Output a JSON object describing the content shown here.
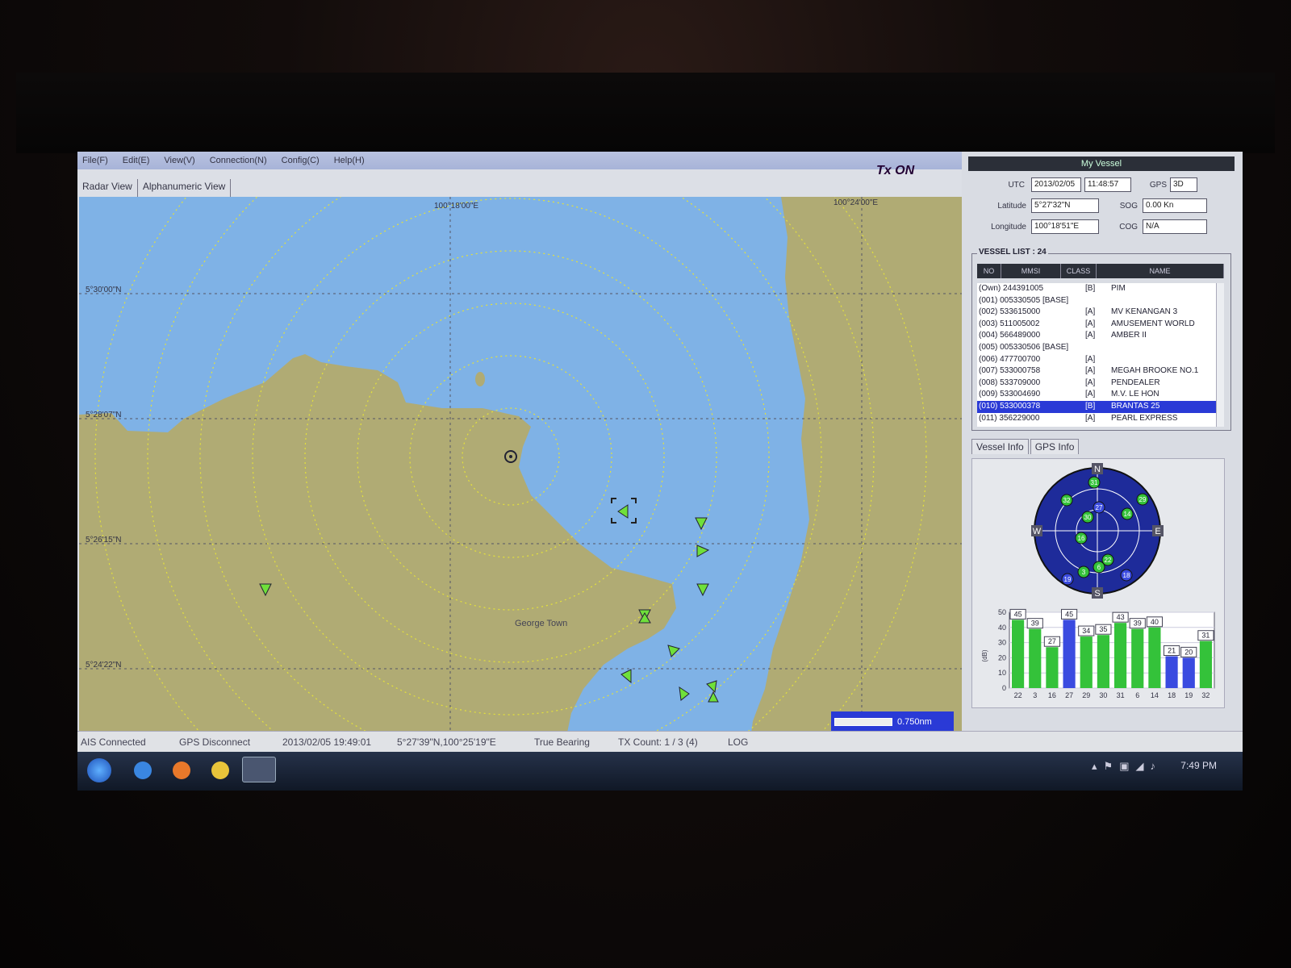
{
  "menu": [
    "File(F)",
    "Edit(E)",
    "View(V)",
    "Connection(N)",
    "Config(C)",
    "Help(H)"
  ],
  "tx_status": "Tx ON",
  "tabs": [
    "Radar View",
    "Alphanumeric View"
  ],
  "map": {
    "lon_labels": [
      "100°18'00\"E",
      "100°24'00\"E"
    ],
    "lat_labels": [
      "5°30'00\"N",
      "5°28'07\"N",
      "5°26'15\"N",
      "5°24'22\"N"
    ],
    "place_label": "George Town",
    "scale": "0.750nm"
  },
  "my_vessel": {
    "title": "My Vessel",
    "utc_label": "UTC",
    "date": "2013/02/05",
    "time": "11:48:57",
    "gps_label": "GPS",
    "gps_fix": "3D",
    "latitude_label": "Latitude",
    "latitude": "5°27'32\"N",
    "longitude_label": "Longitude",
    "longitude": "100°18'51\"E",
    "sog_label": "SOG",
    "sog": "0.00 Kn",
    "cog_label": "COG",
    "cog": "N/A"
  },
  "vessel_list": {
    "title": "VESSEL LIST : 24",
    "columns": [
      "NO",
      "MMSI",
      "CLASS",
      "NAME"
    ],
    "rows": [
      {
        "id": "(Own)  244391005",
        "cls": "[B]",
        "name": "PIM"
      },
      {
        "id": "(001)  005330505 [BASE]",
        "cls": "",
        "name": ""
      },
      {
        "id": "(002)  533615000",
        "cls": "[A]",
        "name": "MV KENANGAN 3"
      },
      {
        "id": "(003)  511005002",
        "cls": "[A]",
        "name": "AMUSEMENT WORLD"
      },
      {
        "id": "(004)  566489000",
        "cls": "[A]",
        "name": "AMBER II"
      },
      {
        "id": "(005)  005330506 [BASE]",
        "cls": "",
        "name": ""
      },
      {
        "id": "(006)  477700700",
        "cls": "[A]",
        "name": ""
      },
      {
        "id": "(007)  533000758",
        "cls": "[A]",
        "name": "MEGAH BROOKE NO.1"
      },
      {
        "id": "(008)  533709000",
        "cls": "[A]",
        "name": "PENDEALER"
      },
      {
        "id": "(009)  533004690",
        "cls": "[A]",
        "name": "M.V. LE HON"
      },
      {
        "id": "(010)  533000378",
        "cls": "[B]",
        "name": "BRANTAS 25"
      },
      {
        "id": "(011)  356229000",
        "cls": "[A]",
        "name": "PEARL EXPRESS"
      }
    ],
    "selected_index": 10
  },
  "info_tabs": [
    "Vessel Info",
    "GPS Info"
  ],
  "sky": {
    "directions": [
      "N",
      "E",
      "S",
      "W"
    ],
    "satellites": [
      {
        "prn": "31",
        "color": "#34c23a"
      },
      {
        "prn": "32",
        "color": "#34c23a"
      },
      {
        "prn": "29",
        "color": "#34c23a"
      },
      {
        "prn": "27",
        "color": "#3a4be0"
      },
      {
        "prn": "14",
        "color": "#34c23a"
      },
      {
        "prn": "30",
        "color": "#34c23a"
      },
      {
        "prn": "16",
        "color": "#34c23a"
      },
      {
        "prn": "22",
        "color": "#34c23a"
      },
      {
        "prn": "6",
        "color": "#34c23a"
      },
      {
        "prn": "3",
        "color": "#34c23a"
      },
      {
        "prn": "18",
        "color": "#3a4be0"
      },
      {
        "prn": "19",
        "color": "#3a4be0"
      }
    ]
  },
  "chart_data": {
    "type": "bar",
    "ylabel": "(dB)",
    "ylim": [
      0,
      50
    ],
    "yticks": [
      0,
      10,
      20,
      30,
      40,
      50
    ],
    "categories": [
      "22",
      "3",
      "16",
      "27",
      "29",
      "30",
      "31",
      "6",
      "14",
      "18",
      "19",
      "32"
    ],
    "values": [
      45,
      39,
      27,
      45,
      34,
      35,
      43,
      39,
      40,
      21,
      20,
      31
    ],
    "colors": [
      "#34c23a",
      "#34c23a",
      "#34c23a",
      "#3a4be0",
      "#34c23a",
      "#34c23a",
      "#34c23a",
      "#34c23a",
      "#34c23a",
      "#3a4be0",
      "#3a4be0",
      "#34c23a"
    ]
  },
  "status_bar": {
    "ais": "AIS Connected",
    "gps": "GPS Disconnect",
    "datetime": "2013/02/05 19:49:01",
    "position": "5°27'39\"N,100°25'19\"E",
    "bearing": "True Bearing",
    "tx_count": "TX Count: 1 / 3 (4)",
    "log": "LOG"
  },
  "taskbar": {
    "clock": "7:49 PM"
  }
}
